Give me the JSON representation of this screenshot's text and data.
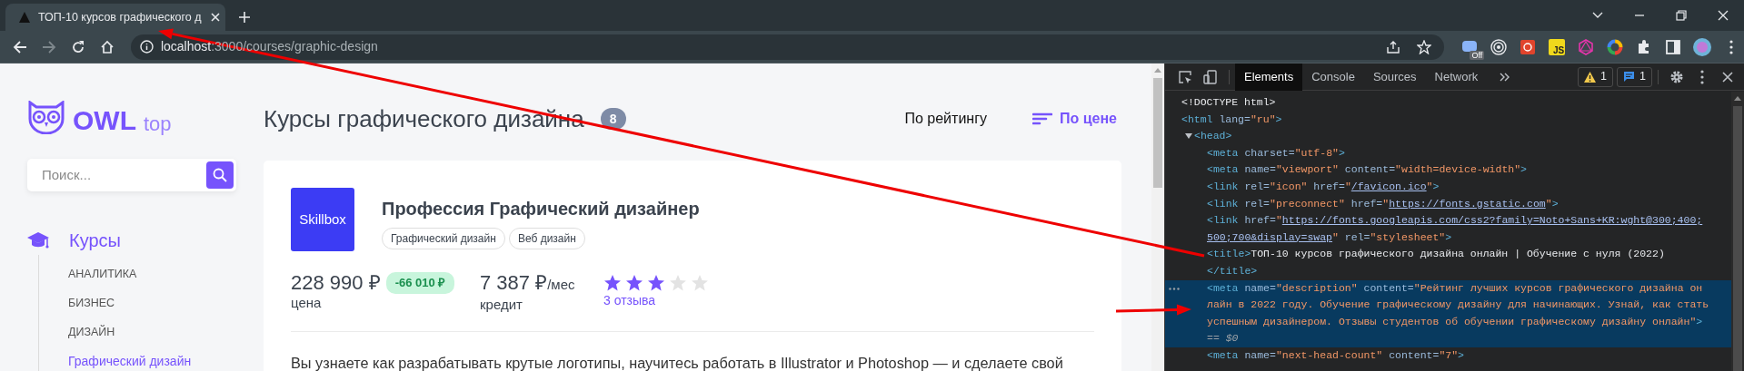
{
  "browser": {
    "tab": {
      "title": "ТОП-10 курсов графического д"
    },
    "address": {
      "host": "localhost",
      "path": ":3000/courses/graphic-design"
    },
    "extensions": [
      {
        "kind": "badge",
        "label": "Off"
      },
      {
        "kind": "target"
      },
      {
        "kind": "app"
      },
      {
        "kind": "js",
        "label": "JS"
      },
      {
        "kind": "hexagon"
      },
      {
        "kind": "wheel"
      }
    ]
  },
  "sidebar": {
    "logo": {
      "name": "OWL",
      "suffix": "top"
    },
    "search": {
      "placeholder": "Поиск..."
    },
    "menu": [
      {
        "label": "Курсы",
        "selected": true,
        "children": [
          {
            "label": "АНАЛИТИКА",
            "selected": false
          },
          {
            "label": "БИЗНЕС",
            "selected": false
          },
          {
            "label": "ДИЗАЙН",
            "selected": false
          },
          {
            "label": "Графический дизайн",
            "selected": true
          }
        ]
      }
    ]
  },
  "main": {
    "title": "Курсы графического дизайна",
    "count": "8",
    "sort": [
      {
        "label": "По рейтингу",
        "selected": false
      },
      {
        "label": "По цене",
        "selected": true
      }
    ],
    "products": [
      {
        "logo": "Skillbox",
        "title": "Профессия Графический дизайнер",
        "tags": [
          "Графический дизайн",
          "Веб дизайн"
        ],
        "price": "228 990 ₽",
        "discount": "-66 010 ₽",
        "price_label": "цена",
        "credit": "7 387 ₽",
        "credit_unit": "/мес",
        "credit_label": "кредит",
        "stars": 3,
        "reviews": "3 отзыва",
        "description": "Вы узнаете как разрабатывать крутые логотипы, научитесь работать в Illustrator и Photoshop — и сделаете свой"
      }
    ]
  },
  "devtools": {
    "tabs": [
      {
        "label": "Elements",
        "selected": true
      },
      {
        "label": "Console",
        "selected": false
      },
      {
        "label": "Sources",
        "selected": false
      },
      {
        "label": "Network",
        "selected": false
      }
    ],
    "warnings": "1",
    "messages": "1",
    "tree": [
      {
        "selected": false,
        "tokens": [
          {
            "kind": "text",
            "text": "<!DOCTYPE html>"
          }
        ]
      },
      {
        "selected": false,
        "tokens": [
          {
            "kind": "tag",
            "text": "<html"
          },
          {
            "kind": "attr",
            "text": " lang="
          },
          {
            "kind": "value",
            "text": "\"ru\""
          },
          {
            "kind": "tag",
            "text": ">"
          }
        ],
        "children": [
          {
            "selected": false,
            "expanded": true,
            "tokens": [
              {
                "kind": "tag",
                "text": "<head>"
              }
            ],
            "children": [
              {
                "selected": false,
                "tokens": [
                  {
                    "kind": "tag",
                    "text": "<meta"
                  },
                  {
                    "kind": "attr",
                    "text": " charset="
                  },
                  {
                    "kind": "value",
                    "text": "\"utf-8\""
                  },
                  {
                    "kind": "tag",
                    "text": ">"
                  }
                ]
              },
              {
                "selected": false,
                "tokens": [
                  {
                    "kind": "tag",
                    "text": "<meta"
                  },
                  {
                    "kind": "attr",
                    "text": " name="
                  },
                  {
                    "kind": "value",
                    "text": "\"viewport\""
                  },
                  {
                    "kind": "attr",
                    "text": " content="
                  },
                  {
                    "kind": "value",
                    "text": "\"width=device-width\""
                  },
                  {
                    "kind": "tag",
                    "text": ">"
                  }
                ]
              },
              {
                "selected": false,
                "tokens": [
                  {
                    "kind": "tag",
                    "text": "<link"
                  },
                  {
                    "kind": "attr",
                    "text": " rel="
                  },
                  {
                    "kind": "value",
                    "text": "\"icon\""
                  },
                  {
                    "kind": "attr",
                    "text": " href="
                  },
                  {
                    "kind": "value",
                    "text": "\""
                  },
                  {
                    "kind": "link",
                    "text": "/favicon.ico"
                  },
                  {
                    "kind": "value",
                    "text": "\""
                  },
                  {
                    "kind": "tag",
                    "text": ">"
                  }
                ]
              },
              {
                "selected": false,
                "tokens": [
                  {
                    "kind": "tag",
                    "text": "<link"
                  },
                  {
                    "kind": "attr",
                    "text": " rel="
                  },
                  {
                    "kind": "value",
                    "text": "\"preconnect\""
                  },
                  {
                    "kind": "attr",
                    "text": " href="
                  },
                  {
                    "kind": "value",
                    "text": "\""
                  },
                  {
                    "kind": "link",
                    "text": "https://fonts.gstatic.com"
                  },
                  {
                    "kind": "value",
                    "text": "\""
                  },
                  {
                    "kind": "tag",
                    "text": ">"
                  }
                ]
              },
              {
                "selected": false,
                "tokens": [
                  {
                    "kind": "tag",
                    "text": "<link"
                  },
                  {
                    "kind": "attr",
                    "text": " href="
                  },
                  {
                    "kind": "value",
                    "text": "\""
                  },
                  {
                    "kind": "link",
                    "text": "https://fonts.googleapis.com/css2?family=Noto+Sans+KR:wght@300;400;500;700&display=swap"
                  },
                  {
                    "kind": "value",
                    "text": "\""
                  },
                  {
                    "kind": "attr",
                    "text": " rel="
                  },
                  {
                    "kind": "value",
                    "text": "\"stylesheet\""
                  },
                  {
                    "kind": "tag",
                    "text": ">"
                  }
                ]
              },
              {
                "selected": false,
                "tokens": [
                  {
                    "kind": "tag",
                    "text": "<title>"
                  },
                  {
                    "kind": "text",
                    "text": "ТОП-10 курсов графического дизайна онлайн | Обучение с нуля (2022)"
                  }
                ],
                "close": [
                  {
                    "kind": "tag",
                    "text": "</title>"
                  }
                ]
              },
              {
                "selected": true,
                "tokens": [
                  {
                    "kind": "tag",
                    "text": "<meta"
                  },
                  {
                    "kind": "attr",
                    "text": " name="
                  },
                  {
                    "kind": "value",
                    "text": "\"description\""
                  },
                  {
                    "kind": "attr",
                    "text": " content="
                  },
                  {
                    "kind": "value",
                    "text": "\"Рейтинг лучших курсов графического дизайна онлайн в 2022 году. Обучение графическому дизайну для начинающих. Узнай, как стать успешным дизайнером. Отзывы студентов об обучении графическому дизайну онлайн\""
                  },
                  {
                    "kind": "tag",
                    "text": ">"
                  }
                ],
                "suffix": "== $0"
              },
              {
                "selected": false,
                "tokens": [
                  {
                    "kind": "tag",
                    "text": "<meta"
                  },
                  {
                    "kind": "attr",
                    "text": " name="
                  },
                  {
                    "kind": "value",
                    "text": "\"next-head-count\""
                  },
                  {
                    "kind": "attr",
                    "text": " content="
                  },
                  {
                    "kind": "value",
                    "text": "\"7\""
                  },
                  {
                    "kind": "tag",
                    "text": ">"
                  }
                ]
              }
            ]
          }
        ]
      }
    ]
  }
}
